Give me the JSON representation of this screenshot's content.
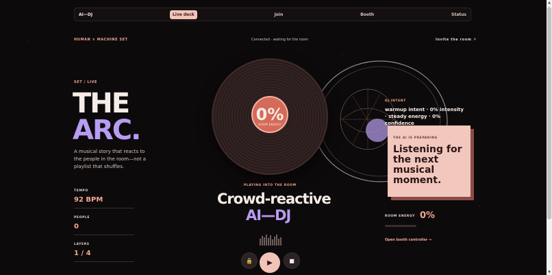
{
  "nav": {
    "brand": "AI—DJ",
    "items": [
      "Live deck",
      "Join",
      "Booth",
      "Status"
    ]
  },
  "header": {
    "set_label": "HUMAN × MACHINE SET",
    "status": "Connected · waiting for the room",
    "invite": "Invite the room ↗"
  },
  "hero": {
    "eyebrow": "SET / LIVE",
    "title_line1": "THE",
    "title_line2": "ARC.",
    "tagline": "A musical story that reacts to the people in the room—not a playlist that shuffles."
  },
  "stats": [
    {
      "label": "TEMPO",
      "value": "92 BPM"
    },
    {
      "label": "PEOPLE",
      "value": "0"
    },
    {
      "label": "LAYERS",
      "value": "1 / 4"
    }
  ],
  "record": {
    "energy_pct": "0%",
    "energy_caption": "ROOM ENERGY"
  },
  "now_playing": {
    "eyebrow": "PLAYING INTO THE ROOM",
    "line1": "Crowd-reactive",
    "line2": "AI—DJ"
  },
  "intent": {
    "eyebrow": "DJ INTENT",
    "text": "warmup intent · 0% intensity · steady energy · 0% confidence"
  },
  "preparing": {
    "eyebrow": "THE AI IS PREPARING",
    "message": "Listening for the next musical moment."
  },
  "room_energy": {
    "label": "ROOM ENERGY",
    "value": "0%",
    "fraction": 0
  },
  "booth_link": "Open booth controller →",
  "controls": {
    "lock_icon": "lock-icon",
    "play_icon": "play-icon",
    "stop_icon": "stop-icon"
  },
  "colors": {
    "accent": "#f2c4b8",
    "peach": "#f2a890",
    "violet": "#b79cf2",
    "background": "#0d0a0b"
  }
}
